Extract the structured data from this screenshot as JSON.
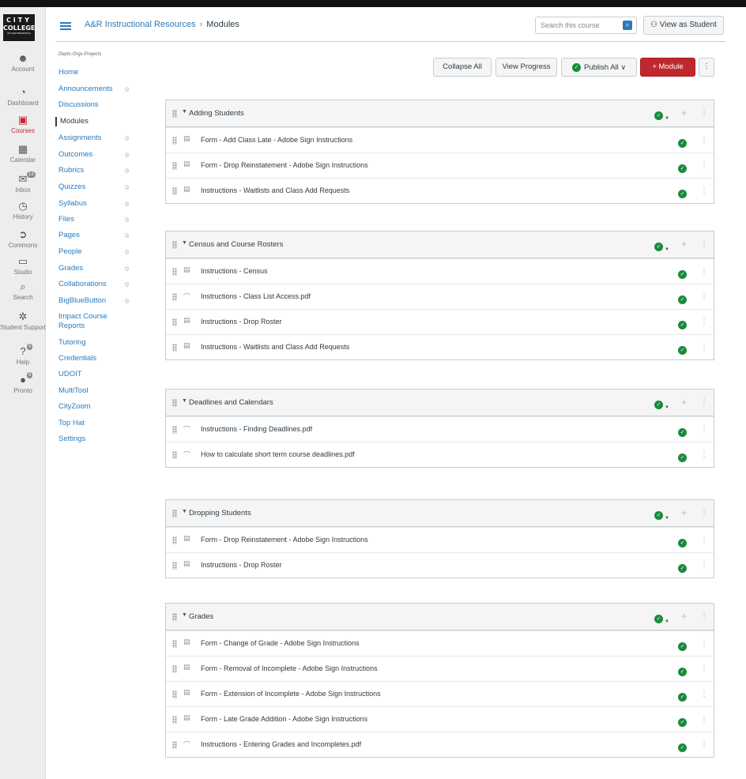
{
  "logo": {
    "line1": "CITY",
    "line2": "COLLEGE",
    "line3": "OF SAN FRANCISCO"
  },
  "global_nav": [
    {
      "label": "Account",
      "icon": "☻",
      "badge": ""
    },
    {
      "label": "Dashboard",
      "icon": "◔",
      "badge": ""
    },
    {
      "label": "Courses",
      "icon": "▣",
      "badge": ""
    },
    {
      "label": "Calendar",
      "icon": "▦",
      "badge": ""
    },
    {
      "label": "Inbox",
      "icon": "✉",
      "badge": "13"
    },
    {
      "label": "History",
      "icon": "◷",
      "badge": ""
    },
    {
      "label": "Commons",
      "icon": "➲",
      "badge": ""
    },
    {
      "label": "Studio",
      "icon": "▭",
      "badge": ""
    },
    {
      "label": "Search",
      "icon": "⌕",
      "badge": ""
    },
    {
      "label": "Student Support",
      "icon": "✲",
      "badge": ""
    },
    {
      "label": "Help",
      "icon": "?",
      "badge": "6"
    },
    {
      "label": "Pronto",
      "icon": "●",
      "badge": "6"
    }
  ],
  "header": {
    "course": "A&R Instructional Resources",
    "separator": "›",
    "page": "Modules",
    "search_placeholder": "Search this course",
    "view_as_student": "View as Student"
  },
  "course_nav": {
    "subtitle": "Depts-Orgs-Projects",
    "items": [
      {
        "label": "Home",
        "hidden": false
      },
      {
        "label": "Announcements",
        "hidden": true
      },
      {
        "label": "Discussions",
        "hidden": false
      },
      {
        "label": "Modules",
        "hidden": false
      },
      {
        "label": "Assignments",
        "hidden": true
      },
      {
        "label": "Outcomes",
        "hidden": true
      },
      {
        "label": "Rubrics",
        "hidden": true
      },
      {
        "label": "Quizzes",
        "hidden": true
      },
      {
        "label": "Syllabus",
        "hidden": true
      },
      {
        "label": "Files",
        "hidden": true
      },
      {
        "label": "Pages",
        "hidden": true
      },
      {
        "label": "People",
        "hidden": true
      },
      {
        "label": "Grades",
        "hidden": true
      },
      {
        "label": "Collaborations",
        "hidden": true
      },
      {
        "label": "BigBlueButton",
        "hidden": true
      },
      {
        "label": "Impact Course Reports",
        "hidden": false
      },
      {
        "label": "Tutoring",
        "hidden": false
      },
      {
        "label": "Credentials",
        "hidden": false
      },
      {
        "label": "UDOIT",
        "hidden": false
      },
      {
        "label": "MultiTool",
        "hidden": false
      },
      {
        "label": "CityZoom",
        "hidden": false
      },
      {
        "label": "Top Hat",
        "hidden": false
      },
      {
        "label": "Settings",
        "hidden": false
      }
    ]
  },
  "toolbar": {
    "collapse_all": "Collapse All",
    "view_progress": "View Progress",
    "publish_all": "Publish All",
    "add_module": "+ Module",
    "more": "⋮"
  },
  "modules": [
    {
      "name": "Adding Students",
      "items": [
        {
          "name": "Form - Add Class Late - Adobe Sign Instructions",
          "type": "page"
        },
        {
          "name": "Form - Drop Reinstatement - Adobe Sign Instructions",
          "type": "page"
        },
        {
          "name": "Instructions - Waitlists and Class Add Requests",
          "type": "page"
        }
      ]
    },
    {
      "name": "Census and Course Rosters",
      "items": [
        {
          "name": "Instructions - Census",
          "type": "page"
        },
        {
          "name": "Instructions - Class List Access.pdf",
          "type": "file"
        },
        {
          "name": "Instructions - Drop Roster",
          "type": "page"
        },
        {
          "name": "Instructions - Waitlists and Class Add Requests",
          "type": "page"
        }
      ]
    },
    {
      "name": "Deadlines and Calendars",
      "items": [
        {
          "name": "Instructions - Finding Deadlines.pdf",
          "type": "file"
        },
        {
          "name": "How to calculate short term course deadlines.pdf",
          "type": "file"
        }
      ]
    },
    {
      "name": "Dropping Students",
      "items": [
        {
          "name": "Form - Drop Reinstatement - Adobe Sign Instructions",
          "type": "page"
        },
        {
          "name": "Instructions - Drop Roster",
          "type": "page"
        }
      ]
    },
    {
      "name": "Grades",
      "items": [
        {
          "name": "Form - Change of Grade - Adobe Sign Instructions",
          "type": "page"
        },
        {
          "name": "Form - Removal of Incomplete - Adobe Sign Instructions",
          "type": "page"
        },
        {
          "name": "Form - Extension of Incomplete - Adobe Sign Instructions",
          "type": "page"
        },
        {
          "name": "Form - Late Grade Addition - Adobe Sign Instructions",
          "type": "page"
        },
        {
          "name": "Instructions - Entering Grades and Incompletes.pdf",
          "type": "file"
        }
      ]
    }
  ],
  "colors": {
    "accent": "#2b7abc",
    "brand_red": "#c0282d",
    "published": "#1a8a3b"
  }
}
